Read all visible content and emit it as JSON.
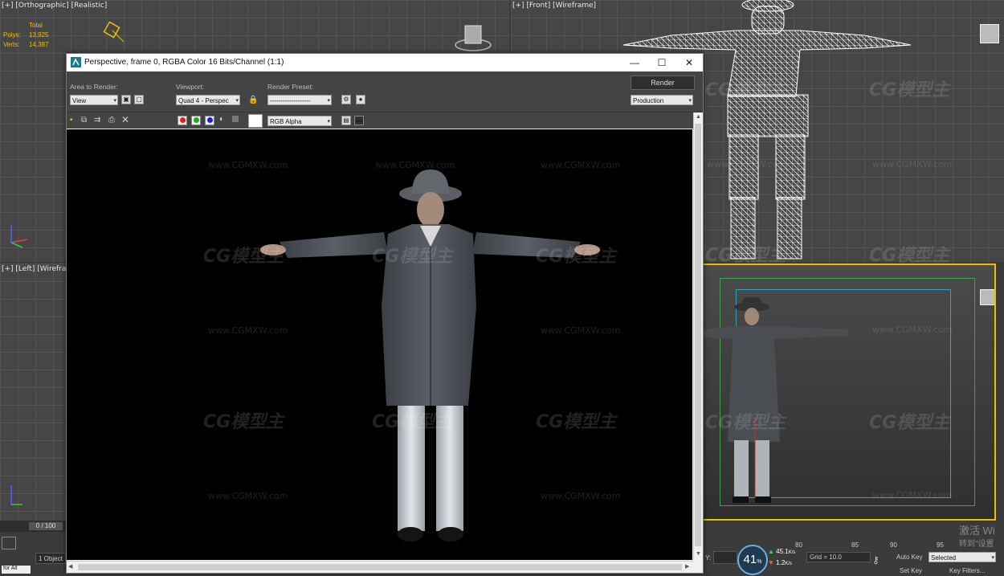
{
  "viewports": {
    "top": {
      "label": "[+] [Orthographic] [Realistic]",
      "stats_total": "Total",
      "polys_label": "Polys:",
      "polys_value": "13,925",
      "verts_label": "Verts:",
      "verts_value": "14,387"
    },
    "front": {
      "label": "[+] [Front] [Wireframe]"
    },
    "left": {
      "label": "[+] [Left] [Wireframe]"
    },
    "perspective": {
      "label": ""
    }
  },
  "render_window": {
    "title": "Perspective, frame 0, RGBA Color 16 Bits/Channel (1:1)",
    "area_label": "Area to Render:",
    "area_value": "View",
    "viewport_label": "Viewport:",
    "viewport_value": "Quad 4 - Perspec",
    "preset_label": "Render Preset:",
    "preset_value": "-------------------",
    "render_button": "Render",
    "mode_value": "Production",
    "channel_value": "RGB Alpha",
    "minimize": "—",
    "maximize": "☐",
    "close": "✕"
  },
  "watermarks": {
    "logo": "CG模型主",
    "url": "www.CGMXW.com"
  },
  "timeline": {
    "frame": "0 / 100",
    "ticks": [
      "80",
      "85",
      "90",
      "95"
    ]
  },
  "status_bar": {
    "selection": "1 Object",
    "script": "for All",
    "percent": "41",
    "percent_sign": "%",
    "speed_up": "45.1",
    "speed_up_unit": "K/s",
    "speed_down": "1.2",
    "speed_down_unit": "K/s",
    "y_label": "Y:",
    "grid": "Grid = 10.0",
    "auto_key": "Auto Key",
    "set_key": "Set Key",
    "selected_value": "Selected",
    "key_filters": "Key Filters...",
    "activate_line1": "激活 Wi",
    "activate_line2": "转到\"设置"
  },
  "colors": {
    "accent": "#e8c000",
    "viewport_bg": "#464646",
    "render_bg": "#000000"
  }
}
